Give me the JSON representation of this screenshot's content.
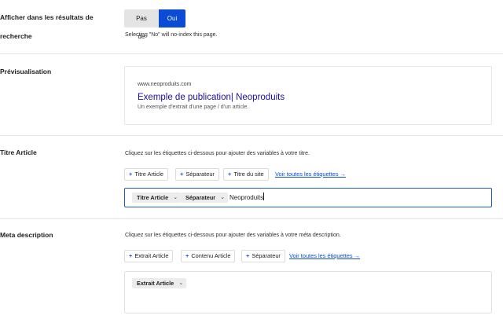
{
  "search_visibility": {
    "label_line1": "Afficher dans les résultats de",
    "label_line2": "recherche",
    "option_no": "Pas de",
    "option_yes": "Oui",
    "hint": "Selecting \"No\" will no-index this page."
  },
  "preview": {
    "label": "Prévisualisation",
    "url": "www.neoproduits.com",
    "title": "Exemple de publication| Neoproduits",
    "description": "Un exemple d'extrait d'une page / d'un article."
  },
  "title_article": {
    "label": "Titre Article",
    "hint": "Cliquez sur les étiquettes ci-dessous pour ajouter des variables à votre titre.",
    "chips": [
      "Titre Article",
      "Séparateur",
      "Titre du site"
    ],
    "all_tags_link": "Voir toutes les étiquettes →",
    "editor_vars": [
      "Titre Article",
      "Séparateur"
    ],
    "editor_text": "Neoproduits"
  },
  "meta_description": {
    "label": "Meta description",
    "hint": "Cliquez sur les étiquettes ci-dessous pour ajouter des variables à votre méta description.",
    "chips": [
      "Extrait Article",
      "Contenu Article",
      "Séparateur"
    ],
    "all_tags_link": "Voir toutes les étiquettes →",
    "editor_vars": [
      "Extrait Article"
    ]
  },
  "icons": {
    "plus": "plus-icon",
    "chevron": "chevron-down-icon"
  },
  "colors": {
    "accent": "#0a4cd6",
    "preview_title": "#1a0dab",
    "editor_focus": "#1f5fbf"
  }
}
